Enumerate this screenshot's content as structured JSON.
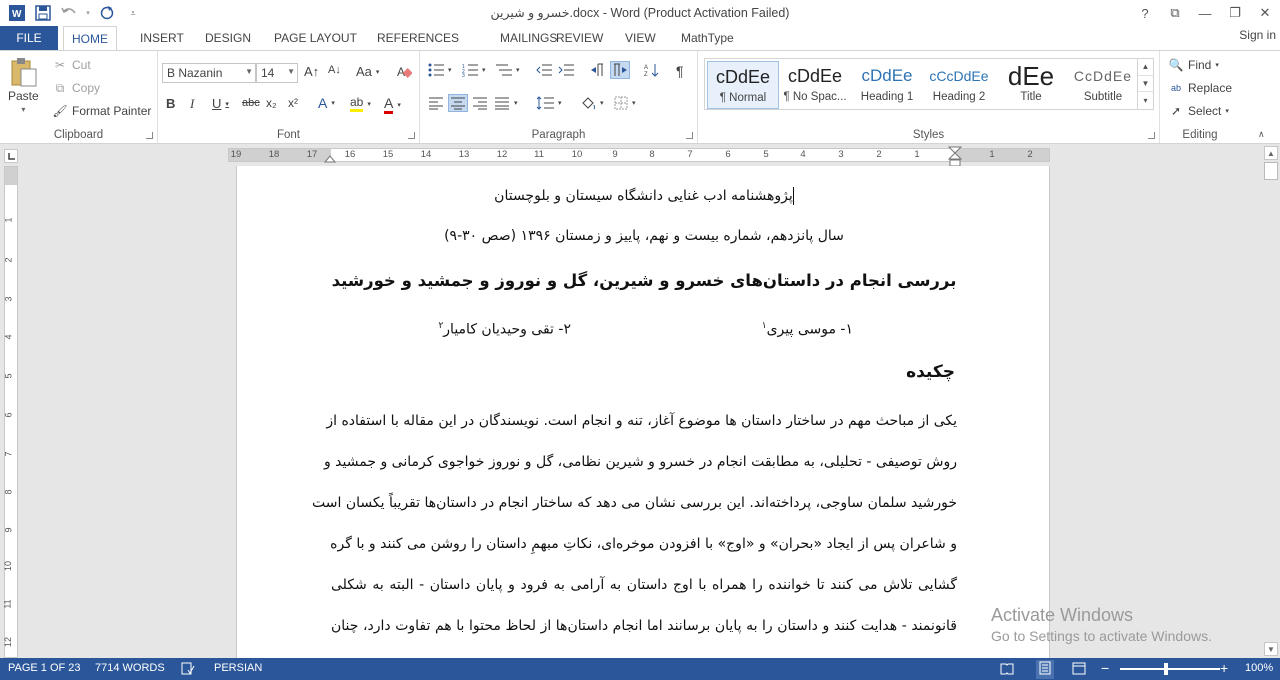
{
  "titlebar": {
    "title": "خسرو و شیرین.docx - Word (Product Activation Failed)",
    "help": "?",
    "ribbon_display": "⧉",
    "minimize": "—",
    "restore": "❐",
    "close": "✕"
  },
  "tabs": {
    "file": "FILE",
    "items": [
      "HOME",
      "INSERT",
      "DESIGN",
      "PAGE LAYOUT",
      "REFERENCES",
      "MAILINGS",
      "REVIEW",
      "VIEW",
      "MathType"
    ],
    "signin": "Sign in"
  },
  "clipboard": {
    "paste": "Paste",
    "cut": "Cut",
    "copy": "Copy",
    "format_painter": "Format Painter",
    "label": "Clipboard"
  },
  "font": {
    "name": "B Nazanin",
    "size": "14",
    "label": "Font",
    "bold": "B",
    "italic": "I",
    "underline": "U",
    "strike": "abc",
    "subscript": "x₂",
    "superscript": "x²",
    "grow": "A↑",
    "shrink": "A↓",
    "case": "Aa",
    "text_effects": "A",
    "highlight": "ab",
    "font_color": "A"
  },
  "paragraph": {
    "label": "Paragraph"
  },
  "styles": {
    "label": "Styles",
    "items": [
      {
        "preview": "cDdEe",
        "name": "¶ Normal"
      },
      {
        "preview": "cDdEe",
        "name": "¶ No Spac..."
      },
      {
        "preview": "cDdEe",
        "name": "Heading 1"
      },
      {
        "preview": "cCcDdEe",
        "name": "Heading 2"
      },
      {
        "preview": "dEe",
        "name": "Title"
      },
      {
        "preview": "CcDdEe",
        "name": "Subtitle"
      }
    ]
  },
  "editing": {
    "find": "Find",
    "replace": "Replace",
    "select": "Select",
    "label": "Editing"
  },
  "ruler": {
    "labels": [
      "19",
      "18",
      "17",
      "16",
      "15",
      "14",
      "13",
      "12",
      "11",
      "10",
      "9",
      "8",
      "7",
      "6",
      "5",
      "4",
      "3",
      "2",
      "1",
      "1",
      "2"
    ]
  },
  "vruler": {
    "labels": [
      "1",
      "2",
      "3",
      "4",
      "5",
      "6",
      "7",
      "8",
      "9",
      "10",
      "11",
      "12"
    ]
  },
  "document": {
    "journal": "پژوهشنامه ادب غنایی دانشگاه سیستان و بلوچستان",
    "issue": "سال پانزدهم، شماره بیست و نهم، پاییز و زمستان ۱۳۹۶ (صص ۳۰-۹)",
    "title": "بررسی انجام در داستان‌های خسرو و شیرین، گل و نوروز و جمشید و خورشید",
    "author1": "۱- موسی پیری",
    "author1_note": "۱",
    "author2": "۲- تقی وحیدیان کامیار",
    "author2_note": "۲",
    "abstract_heading": "چکیده",
    "body": [
      "یکی از مباحث مهم در ساختار داستان ها موضوع آغاز، تنه و انجام است. نویسندگان در این مقاله با استفاده از",
      "روش توصیفی - تحلیلی، به مطابقت انجام در خسرو و شیرین نظامی، گل و نوروز خواجوی کرمانی و جمشید و",
      "خورشید سلمان ساوجی، پرداخته‌اند. این بررسی نشان می دهد که ساختار انجام در داستان‌ها تقریباً یکسان است",
      "و شاعران پس از ایجاد «بحران» و «اوج» با افزودن موخره‌ای، نکاتِ مبهمِ داستان را روشن می کنند و با گره",
      "گشایی تلاش می کنند تا خواننده را همراه با اوج داستان به آرامی به فرود و پایان داستان - البته به شکلی",
      "قانونمند - هدایت کنند و داستان را به پایان برسانند اما انجام داستان‌ها از لحاظ محتوا با هم تفاوت دارد، چنان"
    ]
  },
  "watermark": {
    "line1": "Activate Windows",
    "line2": "Go to Settings to activate Windows."
  },
  "statusbar": {
    "page": "PAGE 1 OF 23",
    "words": "7714 WORDS",
    "language": "PERSIAN",
    "zoom": "100%",
    "zoom_minus": "−",
    "zoom_plus": "+"
  }
}
